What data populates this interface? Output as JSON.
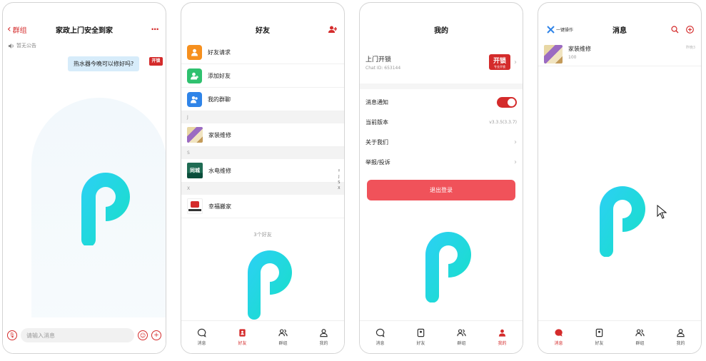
{
  "chat": {
    "back_label": "群组",
    "title": "家政上门安全到家",
    "more_icon": "···",
    "notice": "暂无公告",
    "message": "热水器今晚可以修好吗?",
    "avatar_tag": "开锁",
    "input_placeholder": "请输入消息"
  },
  "friends": {
    "title": "好友",
    "items": [
      {
        "label": "好友请求",
        "color": "#f6901e"
      },
      {
        "label": "添加好友",
        "color": "#2fc16f"
      },
      {
        "label": "我的群聊",
        "color": "#2f84e8"
      }
    ],
    "sections": [
      {
        "letter": "J",
        "name": "家装维修"
      },
      {
        "letter": "S",
        "name": "水电维修"
      },
      {
        "letter": "X",
        "name": "幸福搬家"
      }
    ],
    "index_letters": [
      "↑",
      "J",
      "S",
      "X"
    ],
    "count": "3个好友"
  },
  "me": {
    "title": "我的",
    "user_name": "上门开锁",
    "chat_id": "Chat ID: 653144",
    "badge_text": "开锁",
    "badge_sub": "专业开锁",
    "rows": {
      "notify": "消息通知",
      "version": "当前版本",
      "version_value": "v3.3.5(3.3.7)",
      "about": "关于我们",
      "report": "举报/投诉"
    },
    "logout": "退出登录"
  },
  "messages": {
    "one_key": "一键操作",
    "title": "消息",
    "item_title": "家装维修",
    "item_sub": "100",
    "item_time": "昨晚3"
  },
  "tabs": {
    "messages": "消息",
    "friends": "好友",
    "groups": "群组",
    "me": "我的"
  },
  "colors": {
    "accent": "#d42b2b",
    "logout": "#f0525a",
    "bubble": "#d7ecfa"
  }
}
